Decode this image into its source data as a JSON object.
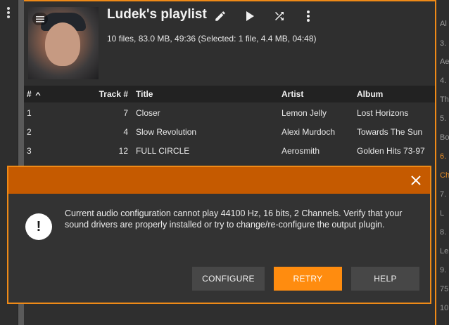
{
  "playlist": {
    "title": "Ludek's playlist",
    "stats": "10 files, 83.0 MB, 49:36 (Selected: 1 file, 4.4 MB, 04:48)"
  },
  "table": {
    "headers": {
      "num": "#",
      "track": "Track #",
      "title": "Title",
      "artist": "Artist",
      "album": "Album"
    },
    "rows": [
      {
        "num": "1",
        "track": "7",
        "title": "Closer",
        "artist": "Lemon Jelly",
        "album": "Lost Horizons"
      },
      {
        "num": "2",
        "track": "4",
        "title": "Slow Revolution",
        "artist": "Alexi Murdoch",
        "album": "Towards The Sun"
      },
      {
        "num": "3",
        "track": "12",
        "title": "FULL CIRCLE",
        "artist": "Aerosmith",
        "album": "Golden Hits 73-97"
      }
    ]
  },
  "right_list": [
    "Al",
    "3.",
    "Ae",
    "4.",
    "Th",
    "5.",
    "Bo",
    "6.",
    "Ch",
    "7.",
    "L",
    "8.",
    "Le",
    "9.",
    "75",
    "10"
  ],
  "right_list_active": [
    "6.",
    "Ch"
  ],
  "dialog": {
    "message": "Current audio configuration cannot play 44100 Hz, 16 bits, 2 Channels. Verify that your sound drivers are properly installed or try to change/re-configure the output plugin.",
    "alert_symbol": "!",
    "buttons": {
      "configure": "CONFIGURE",
      "retry": "RETRY",
      "help": "HELP"
    }
  },
  "colors": {
    "accent": "#ef8a17",
    "dialog_header": "#c55a00",
    "retry": "#ff8c0f",
    "active_item": "#e08a2a"
  },
  "icons": [
    "kebab-menu-icon",
    "list-icon",
    "edit-pencil-icon",
    "play-icon",
    "shuffle-icon",
    "more-vert-icon",
    "sort-ascending-icon",
    "close-icon",
    "alert-icon"
  ]
}
